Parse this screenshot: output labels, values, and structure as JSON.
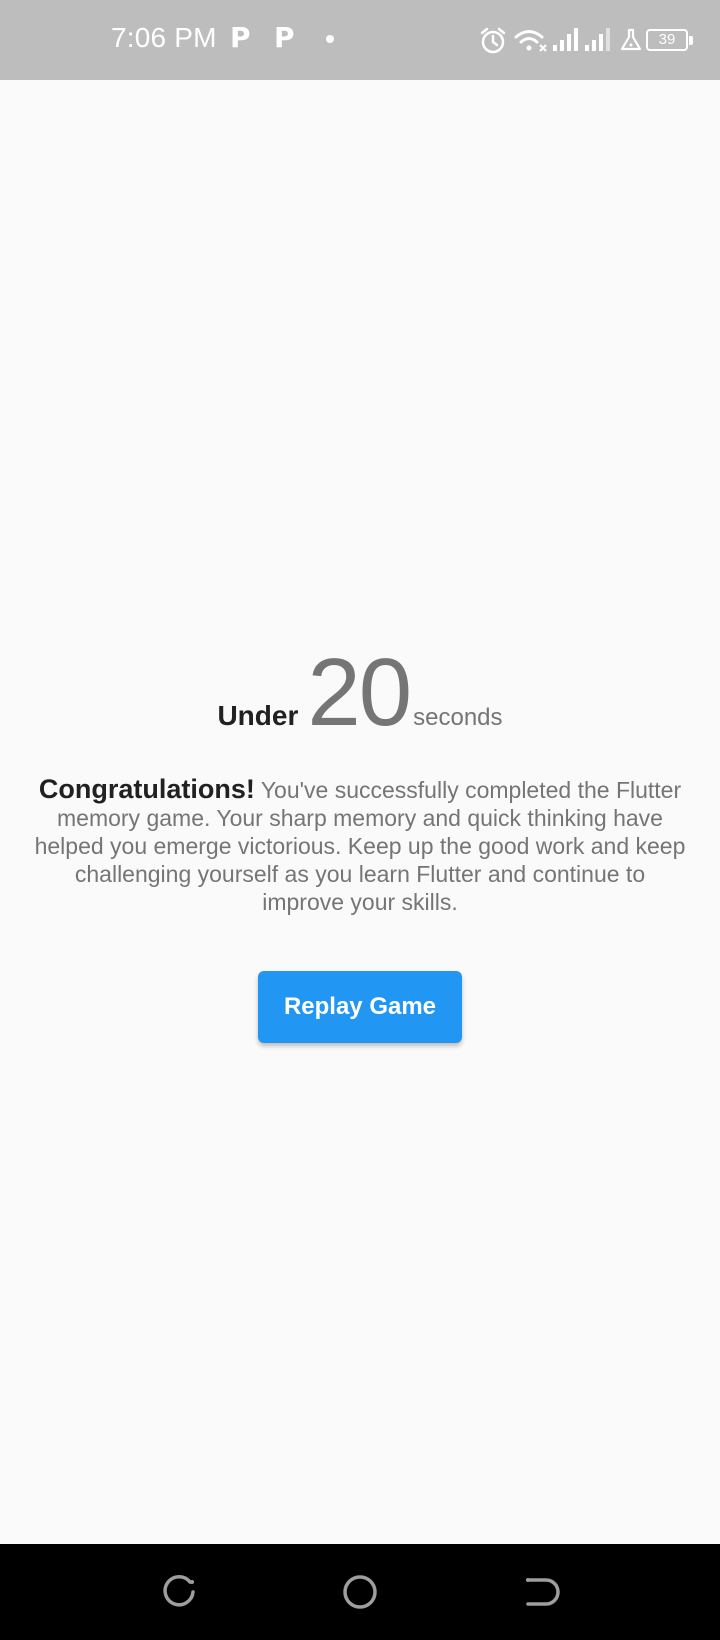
{
  "status_bar": {
    "time": "7:06 PM",
    "notification_icons": [
      "p-icon",
      "p-icon",
      "dot-icon"
    ],
    "system_icons": [
      "alarm-icon",
      "wifi-off-icon",
      "signal-icon",
      "signal-weak-icon",
      "flask-icon",
      "battery-icon"
    ],
    "battery_level": "39"
  },
  "result": {
    "prefix": "Under",
    "time_value": "20",
    "unit": "seconds"
  },
  "message": {
    "title": "Congratulations!",
    "body": " You've successfully completed the Flutter memory game. Your sharp memory and quick thinking have helped you emerge victorious. Keep up the good work and keep challenging yourself as you learn Flutter and continue to improve your skills."
  },
  "actions": {
    "replay_label": "Replay Game"
  },
  "colors": {
    "accent": "#2196f3",
    "status_bar": "#bdbdbd",
    "background": "#fafafa",
    "nav_bar": "#000000"
  },
  "nav_bar": {
    "buttons": [
      "recent-apps-icon",
      "home-icon",
      "back-icon"
    ]
  }
}
